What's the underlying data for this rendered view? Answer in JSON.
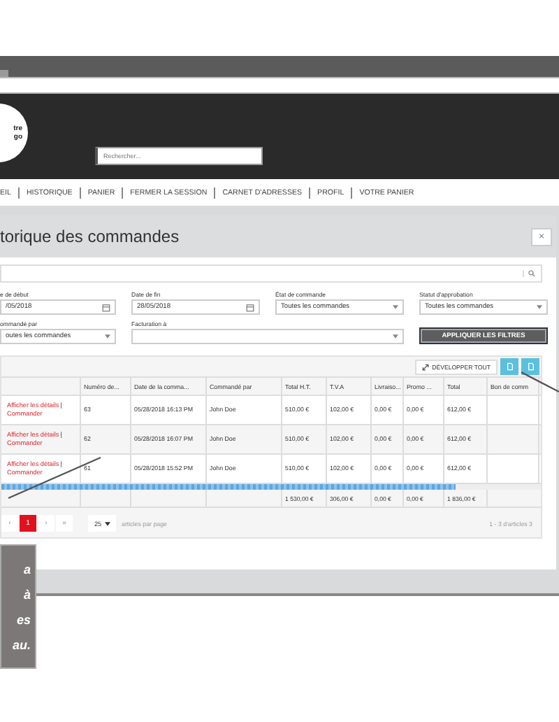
{
  "header": {
    "logo_lines": [
      "tre",
      "go"
    ],
    "search": {
      "placeholder": "Rechercher..."
    }
  },
  "nav": [
    {
      "label": "EIL"
    },
    {
      "label": "HISTORIQUE"
    },
    {
      "label": "PANIER"
    },
    {
      "label": "FERMER LA SESSION"
    },
    {
      "label": "CARNET D'ADRESSES"
    },
    {
      "label": "PROFIL"
    },
    {
      "label": "VOTRE PANIER"
    }
  ],
  "modal": {
    "title": "torique des commandes",
    "close": "×"
  },
  "filters": [
    {
      "label": "e de début",
      "value": "/05/2018",
      "kind": "date"
    },
    {
      "label": "Date de fin",
      "value": "28/05/2018",
      "kind": "date"
    },
    {
      "label": "État de commande",
      "value": "Toutes les commandes",
      "kind": "select"
    },
    {
      "label": "Statut d'approbation",
      "value": "Toutes les commandes",
      "kind": "select"
    },
    {
      "label": "ommandé par",
      "value": "outes les commandes",
      "kind": "select"
    },
    {
      "label": "Facturation à",
      "kind": "select"
    }
  ],
  "apply_button": "APPLIQUER LES FILTRES",
  "expand_button": "DÉVELOPPER TOUT",
  "table": {
    "columns": [
      "Numéro de...",
      "Date de la comma...",
      "Commandé par",
      "Total H.T.",
      "T.V.A",
      "Livraiso...",
      "Promo ...",
      "Total",
      "Bon de comm"
    ],
    "rows": [
      {
        "view": "Afficher les détails",
        "separator": "|",
        "order": "Commander",
        "cells": [
          "63",
          "05/28/2018 16:13 PM",
          "John Doe",
          "510,00 €",
          "102,00 €",
          "0,00 €",
          "0,00 €",
          "612,00 €"
        ]
      },
      {
        "view": "Afficher les détails",
        "separator": "|",
        "order": "Commander",
        "cells": [
          "62",
          "05/28/2018 16:07 PM",
          "John Doe",
          "510,00 €",
          "102,00 €",
          "0,00 €",
          "0,00 €",
          "612,00 €"
        ]
      },
      {
        "view": "Afficher les détails",
        "separator": "|",
        "order": "Commander",
        "cells": [
          "61",
          "05/28/2018 15:52 PM",
          "John Doe",
          "510,00 €",
          "102,00 €",
          "0,00 €",
          "0,00 €",
          "612,00 €"
        ]
      }
    ],
    "totals": [
      "1 530,00 €",
      "306,00 €",
      "0,00 €",
      "0,00 €",
      "1 836,00 €"
    ]
  },
  "pagination": {
    "buttons": [
      {
        "label": "‹",
        "selected": false
      },
      {
        "label": "1",
        "selected": true
      },
      {
        "label": "›",
        "selected": false
      },
      {
        "label": "»",
        "selected": false
      }
    ],
    "page_size": "25",
    "per_page_label": "articles par page",
    "range": "1 - 3 d'articles 3"
  },
  "callout": {
    "lines": [
      "a",
      "à",
      "es",
      "au."
    ]
  }
}
